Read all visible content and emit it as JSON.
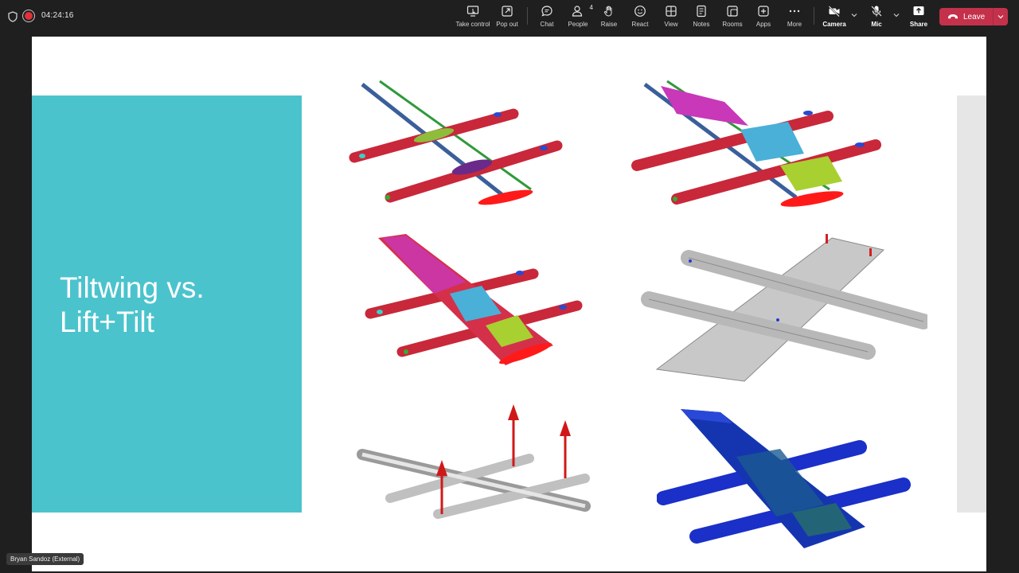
{
  "meeting": {
    "timer": "04:24:16"
  },
  "toolbar": {
    "take_control": "Take control",
    "pop_out": "Pop out",
    "chat": "Chat",
    "people": "People",
    "people_count": "4",
    "raise": "Raise",
    "react": "React",
    "view": "View",
    "notes": "Notes",
    "rooms": "Rooms",
    "apps": "Apps",
    "more": "More",
    "camera": "Camera",
    "mic": "Mic",
    "share": "Share",
    "leave": "Leave"
  },
  "colors": {
    "leave_button": "#c4314b",
    "slide_panel": "#4bc3cd",
    "recording": "#e0303a"
  },
  "slide": {
    "title": "Tiltwing vs.\nLift+Tilt"
  },
  "participant": {
    "name": "Bryan Sandoz (External)"
  }
}
